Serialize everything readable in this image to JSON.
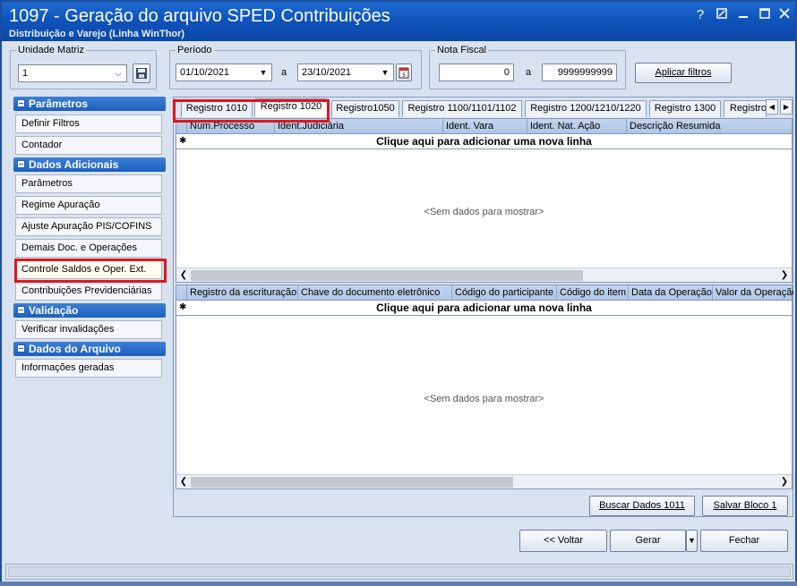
{
  "window": {
    "title": "1097 - Geração do arquivo SPED Contribuições",
    "subtitle": "Distribuição e Varejo (Linha WinThor)",
    "help_icon": "?",
    "controls": [
      "?",
      "restore",
      "minimize",
      "maximize",
      "close"
    ]
  },
  "filters": {
    "unidade_label": "Unidade Matriz",
    "unidade_value": "1",
    "periodo_label": "Período",
    "date_from": "01/10/2021",
    "date_sep": "a",
    "date_to": "23/10/2021",
    "nota_label": "Nota Fiscal",
    "nota_from": "0",
    "nota_sep": "a",
    "nota_to": "9999999999",
    "apply_button": "Aplicar filtros"
  },
  "sidebar": {
    "sections": [
      {
        "title": "Parâmetros",
        "items": [
          "Definir Filtros",
          "Contador"
        ]
      },
      {
        "title": "Dados Adicionais",
        "items": [
          "Parâmetros",
          "Regime Apuração",
          "Ajuste Apuração PIS/COFINS",
          "Demais Doc. e Operações",
          "Controle Saldos e Oper. Ext.",
          "Contribuições Previdenciárias"
        ]
      },
      {
        "title": "Validação",
        "items": [
          "Verificar invalidações"
        ]
      },
      {
        "title": "Dados do Arquivo",
        "items": [
          "Informações geradas"
        ]
      }
    ]
  },
  "tabs": [
    "Registro 1010",
    "Registro 1020",
    "Registro1050",
    "Registro 1100/1101/1102",
    "Registro 1200/1210/1220",
    "Registro 1300",
    "Registro"
  ],
  "grid_top": {
    "columns": [
      "Núm.Processo",
      "Ident.Judiciária",
      "Ident. Vara",
      "Ident. Nat. Ação",
      "Descrição Resumida"
    ],
    "new_row": "Clique aqui para adicionar uma nova linha",
    "empty": "<Sem dados para mostrar>"
  },
  "grid_bottom": {
    "columns": [
      "Registro da escrituração",
      "Chave do documento eletrônico",
      "Código do participante",
      "Código do item",
      "Data da Operação",
      "Valor da Operação"
    ],
    "new_row": "Clique aqui para adicionar uma nova linha",
    "empty": "<Sem dados para mostrar>"
  },
  "panel_buttons": {
    "buscar": "Buscar Dados 1011",
    "salvar": "Salvar Bloco 1"
  },
  "footer_buttons": {
    "voltar": "<< Voltar",
    "gerar": "Gerar",
    "fechar": "Fechar"
  },
  "colors": {
    "titlebar": "#0f54bb",
    "highlight": "#e4141c",
    "section_header": "#1d5fbd"
  }
}
